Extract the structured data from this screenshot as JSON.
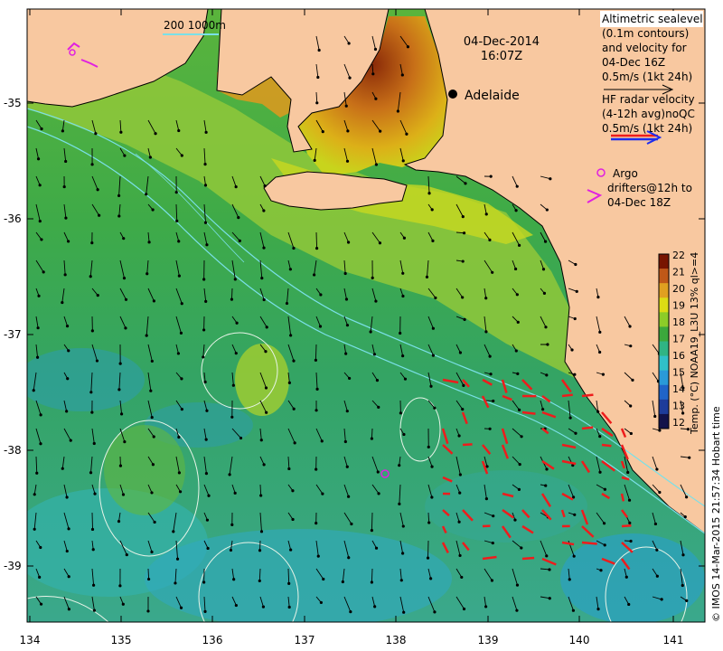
{
  "map": {
    "date": "04-Dec-2014",
    "time": "16:07Z",
    "city": "Adelaide",
    "scale_label": "200  1000m",
    "lon_ticks": [
      "134",
      "135",
      "136",
      "137",
      "138",
      "139",
      "140",
      "141"
    ],
    "lat_ticks": [
      "-35",
      "-36",
      "-37",
      "-38",
      "-39"
    ]
  },
  "legend": {
    "altimetric": [
      "Altimetric sealevel",
      "(0.1m contours)",
      "and velocity for",
      "04-Dec 16Z",
      "0.5m/s (1kt 24h)"
    ],
    "hf_radar": [
      "HF radar velocity",
      "(4-12h avg)noQC",
      "0.5m/s (1kt 24h)"
    ],
    "argo": [
      "Argo",
      "drifters@12h to",
      "04-Dec 18Z"
    ]
  },
  "colorbar": {
    "ticks": [
      "12",
      "13",
      "14",
      "15",
      "16",
      "17",
      "18",
      "19",
      "20",
      "21",
      "22"
    ],
    "colors": [
      "#12124a",
      "#1e3c9a",
      "#2064c8",
      "#2a9ad8",
      "#30c0c8",
      "#30b484",
      "#3ca83c",
      "#8ccc28",
      "#dcdc14",
      "#e0a020",
      "#c05818",
      "#781400"
    ],
    "label": "Temp. (°C) NOAA19_L3U 13% ql>=4"
  },
  "credit": "© IMOS 14-Mar-2015 21:57:34 Hobart time",
  "colors": {
    "land": "#f8c8a0",
    "sea": "#3ca84a",
    "shelf": "#8cc43c",
    "hf_arrow": "#ee1c1c",
    "argo": "#e020e0"
  }
}
